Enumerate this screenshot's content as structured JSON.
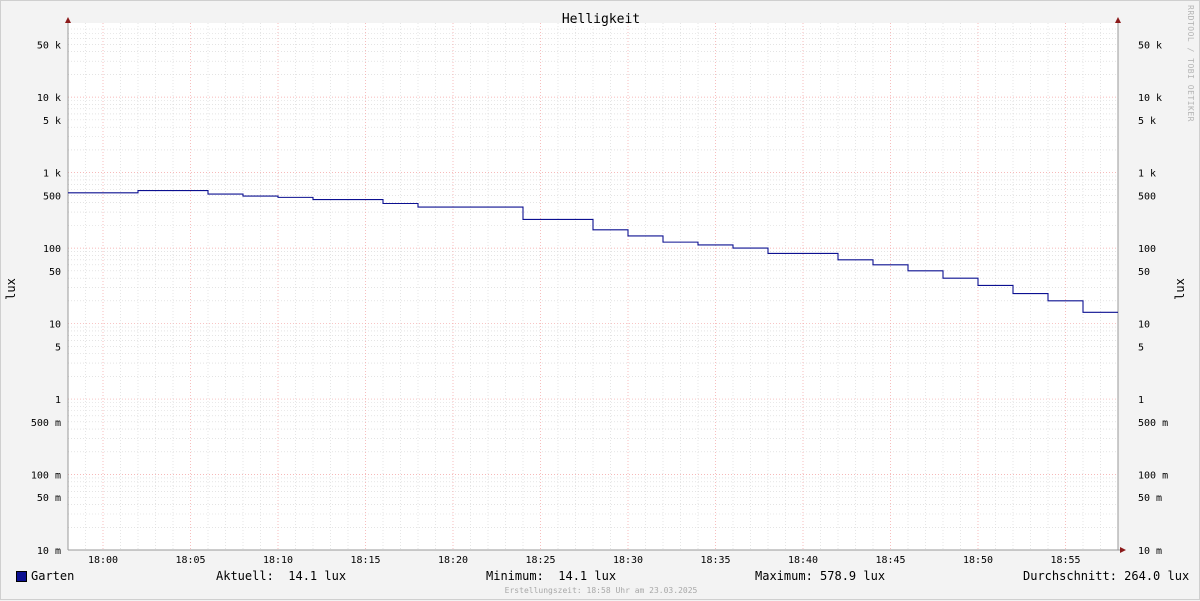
{
  "title": "Helligkeit",
  "watermark": "RRDTOOL / TOBI OETIKER",
  "footer": "Erstellungszeit: 18:58 Uhr am 23.03.2025",
  "legend": {
    "series_name": "Garten",
    "aktuell": "Aktuell:  14.1 lux",
    "minimum": "Minimum:  14.1 lux",
    "maximum": "Maximum: 578.9 lux",
    "durchschnitt": "Durchschnitt: 264.0 lux"
  },
  "colors": {
    "series": "#0c1091",
    "major_grid": "#f4a3a3",
    "minor_grid": "#d4d4d4",
    "axis": "#999999",
    "arrow": "#8b1a1a"
  },
  "chart_data": {
    "type": "line",
    "title": "Helligkeit",
    "ylabel": "lux",
    "yscale": "log",
    "ylim": [
      0.01,
      80000
    ],
    "xlim_minutes": [
      -2.0,
      58.0
    ],
    "grid": true,
    "x_ticks": [
      {
        "m": 0,
        "label": "18:00"
      },
      {
        "m": 5,
        "label": "18:05"
      },
      {
        "m": 10,
        "label": "18:10"
      },
      {
        "m": 15,
        "label": "18:15"
      },
      {
        "m": 20,
        "label": "18:20"
      },
      {
        "m": 25,
        "label": "18:25"
      },
      {
        "m": 30,
        "label": "18:30"
      },
      {
        "m": 35,
        "label": "18:35"
      },
      {
        "m": 40,
        "label": "18:40"
      },
      {
        "m": 45,
        "label": "18:45"
      },
      {
        "m": 50,
        "label": "18:50"
      },
      {
        "m": 55,
        "label": "18:55"
      }
    ],
    "y_ticks": [
      {
        "v": 50000,
        "label": "50 k"
      },
      {
        "v": 10000,
        "label": "10 k"
      },
      {
        "v": 5000,
        "label": "5 k"
      },
      {
        "v": 1000,
        "label": "1 k"
      },
      {
        "v": 500,
        "label": "500"
      },
      {
        "v": 100,
        "label": "100"
      },
      {
        "v": 50,
        "label": "50"
      },
      {
        "v": 10,
        "label": "10"
      },
      {
        "v": 5,
        "label": "5"
      },
      {
        "v": 1,
        "label": "1"
      },
      {
        "v": 0.5,
        "label": "500 m"
      },
      {
        "v": 0.1,
        "label": "100 m"
      },
      {
        "v": 0.05,
        "label": "50 m"
      },
      {
        "v": 0.01,
        "label": "10 m"
      }
    ],
    "series": [
      {
        "name": "Garten",
        "step": true,
        "x": [
          -2,
          2,
          6,
          8,
          10,
          12,
          16,
          18,
          24,
          28,
          30,
          32,
          34,
          36,
          38,
          42,
          44,
          46,
          48,
          50,
          52,
          54,
          56,
          58
        ],
        "y": [
          540,
          578.9,
          520,
          490,
          470,
          440,
          390,
          350,
          240,
          175,
          145,
          120,
          110,
          100,
          85,
          70,
          60,
          50,
          40,
          32,
          25,
          20,
          14.1,
          14.1
        ]
      }
    ]
  }
}
